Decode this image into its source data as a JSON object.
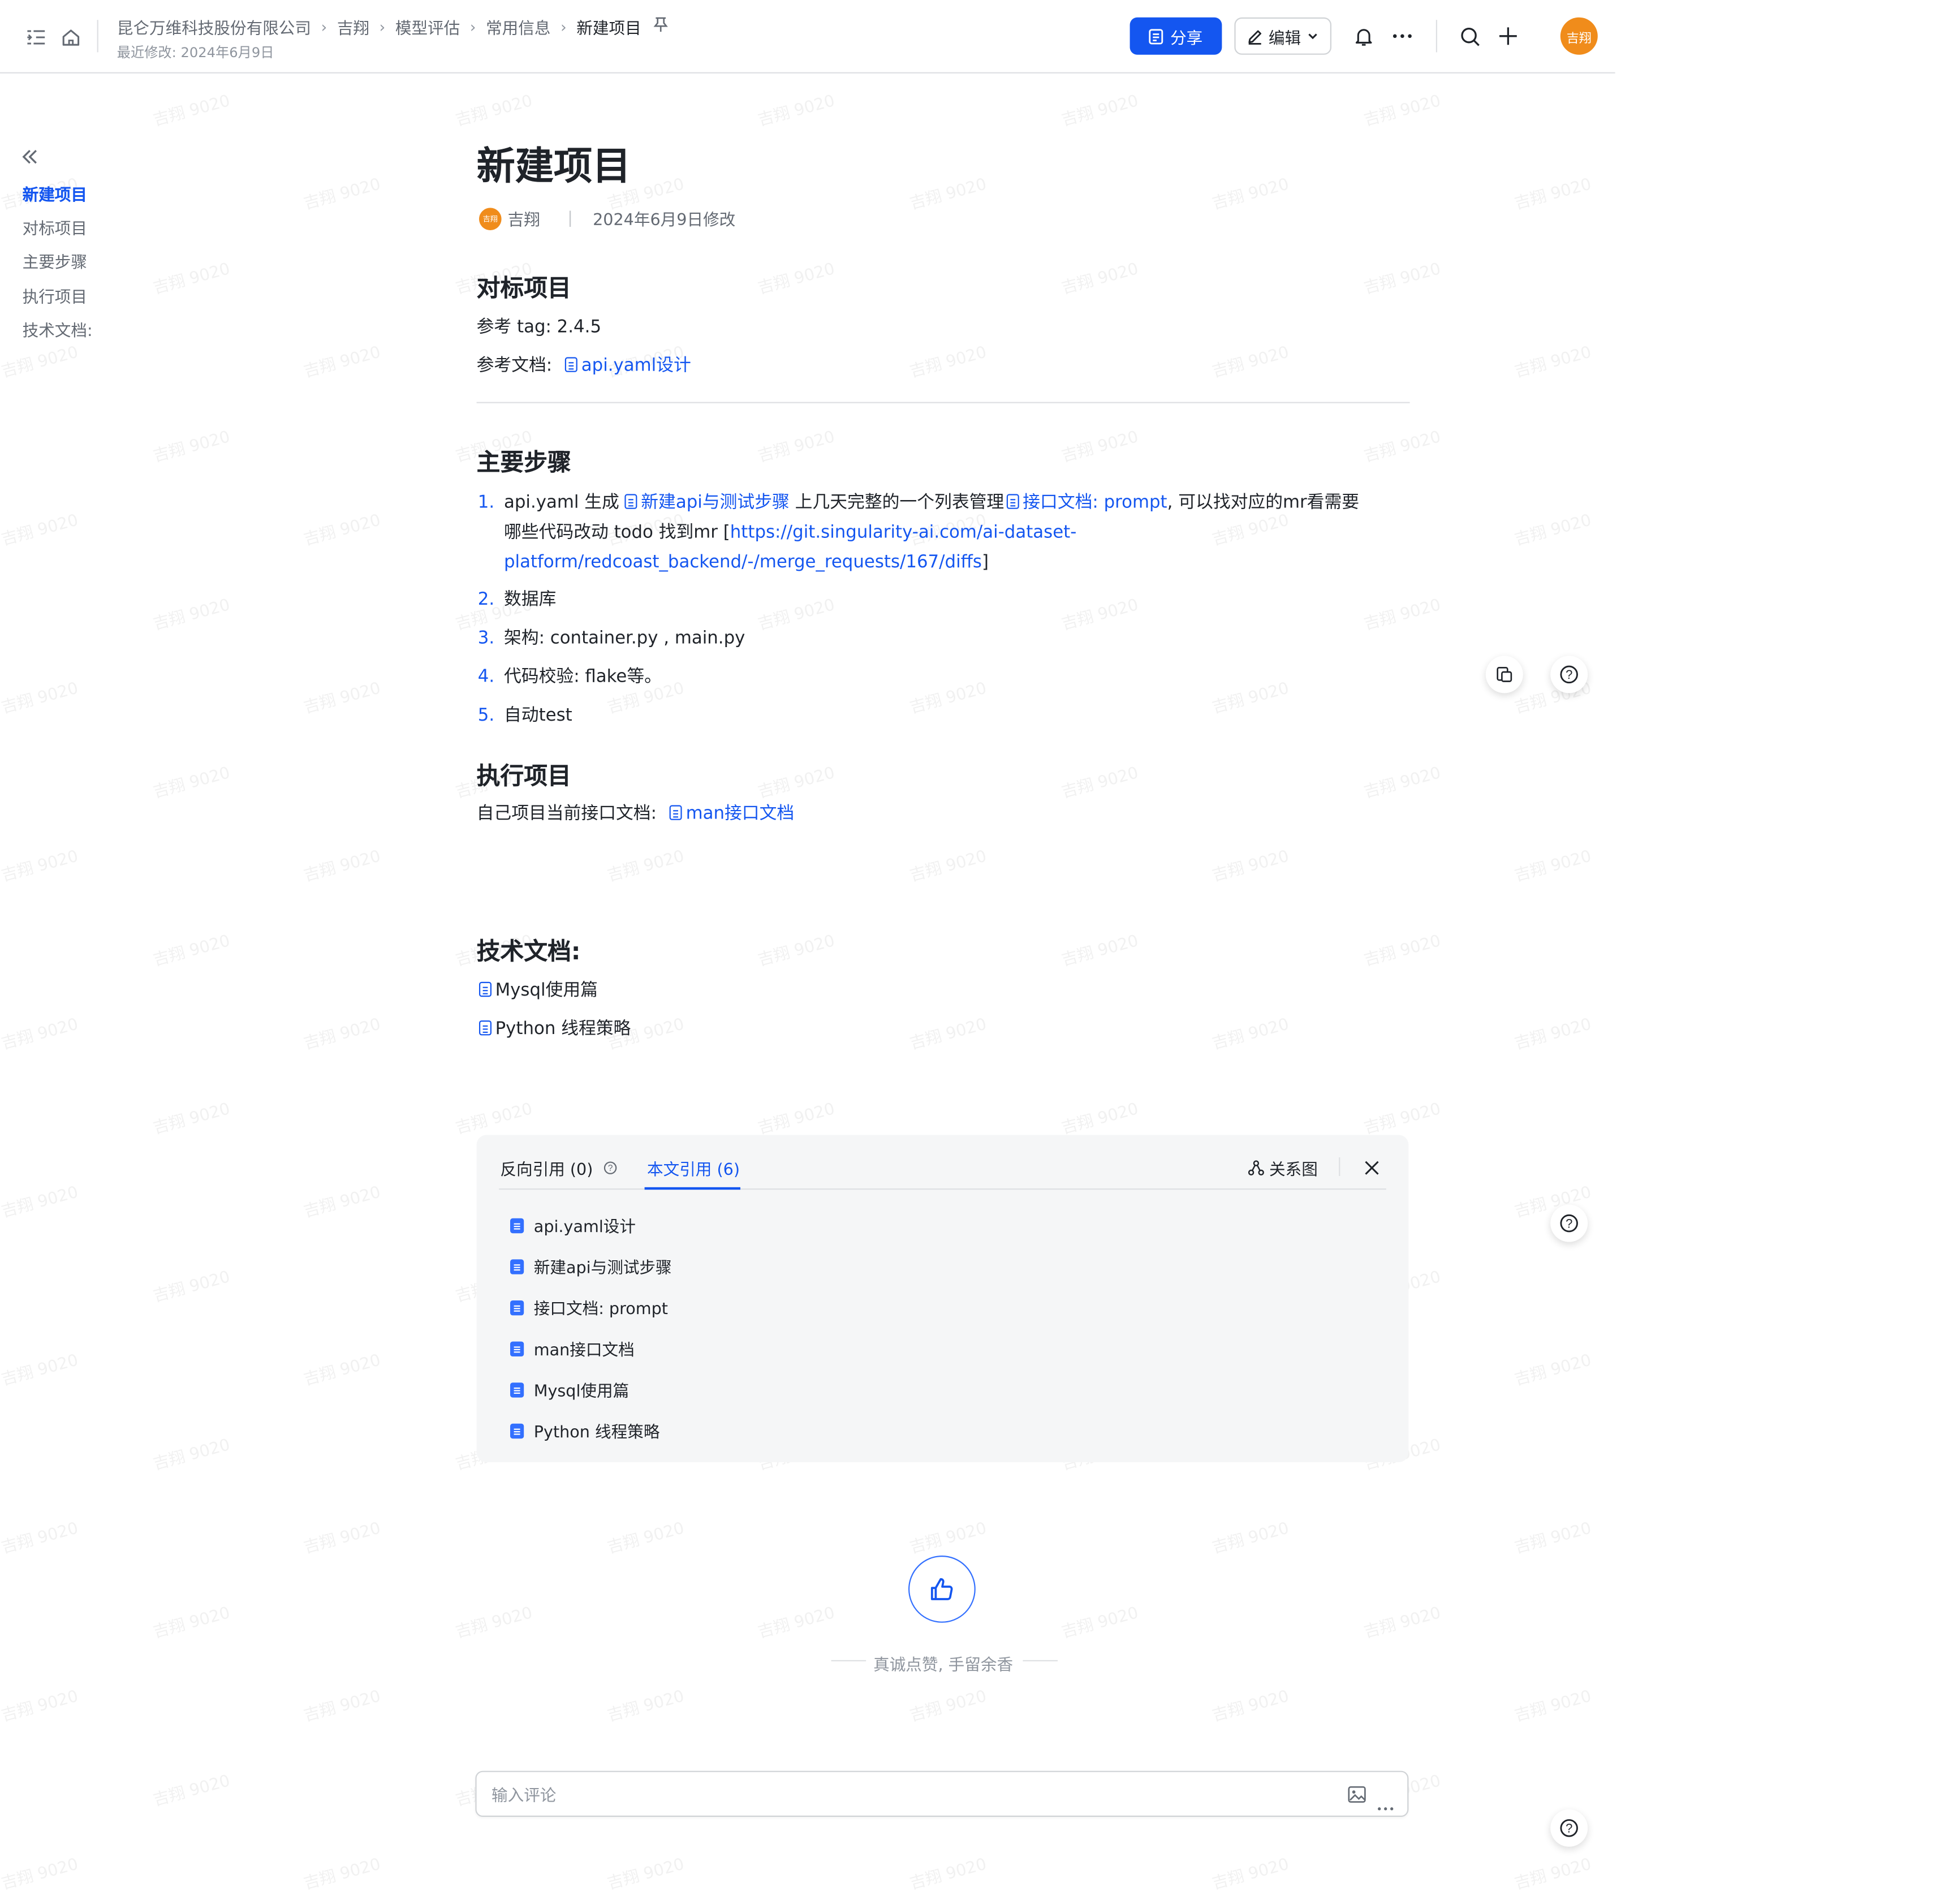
{
  "breadcrumb": {
    "items": [
      "昆仑万维科技股份有限公司",
      "吉翔",
      "模型评估",
      "常用信息",
      "新建项目"
    ],
    "last_modified": "最近修改: 2024年6月9日"
  },
  "toolbar": {
    "share_label": "分享",
    "edit_label": "编辑",
    "avatar_text": "吉翔"
  },
  "toc": {
    "items": [
      "新建项目",
      "对标项目",
      "主要步骤",
      "执行项目",
      "技术文档:"
    ],
    "active_index": 0
  },
  "doc": {
    "title": "新建项目",
    "author": "吉翔",
    "avatar_text": "吉翔",
    "modified": "2024年6月9日修改",
    "sections": {
      "benchmark": {
        "heading": "对标项目",
        "tag_label": "参考 tag:",
        "tag_value": "2.4.5",
        "ref_label": "参考文档:",
        "ref_link": "api.yaml设计"
      },
      "steps": {
        "heading": "主要步骤",
        "items": [
          {
            "num": "1.",
            "t1": "api.yaml 生成 ",
            "link1": "新建api与测试步骤",
            "t2": " 上几天完整的一个列表管理",
            "link2": "接口文档: prompt",
            "t3": ", 可以找对应的mr看需要",
            "t4": "哪些代码改动 todo 找到mr [",
            "url1": "https://git.singularity-ai.com/ai-dataset-",
            "url2": "platform/redcoast_backend/-/merge_requests/167/diffs",
            "t5": "]"
          },
          {
            "num": "2.",
            "text": "数据库"
          },
          {
            "num": "3.",
            "text": "架构: container.py , main.py"
          },
          {
            "num": "4.",
            "text": "代码校验: flake等。"
          },
          {
            "num": "5.",
            "text": "自动test"
          }
        ]
      },
      "exec": {
        "heading": "执行项目",
        "label": "自己项目当前接口文档:",
        "link": "man接口文档"
      },
      "tech": {
        "heading": "技术文档:",
        "links": [
          "Mysql使用篇",
          "Python 线程策略"
        ]
      }
    }
  },
  "references": {
    "tab_back": "反向引用 (0)",
    "tab_this": "本文引用 (6)",
    "graph_label": "关系图",
    "items": [
      "api.yaml设计",
      "新建api与测试步骤",
      "接口文档: prompt",
      "man接口文档",
      "Mysql使用篇",
      "Python 线程策略"
    ]
  },
  "like": {
    "text": "真诚点赞, 手留余香"
  },
  "comment": {
    "placeholder": "输入评论"
  },
  "watermark": {
    "text": "吉翔 9020"
  },
  "colors": {
    "accent": "#1456f0",
    "avatar": "#f08c1b",
    "panel_bg": "#f5f6f7"
  }
}
